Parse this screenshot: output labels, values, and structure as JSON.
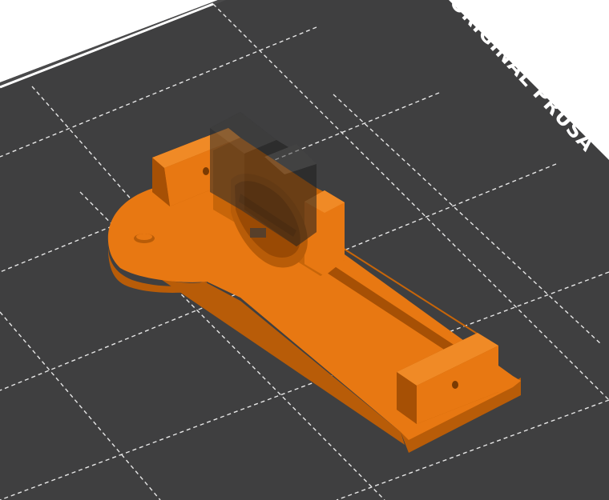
{
  "viewer": {
    "bed_label": "ORIGINAL PRUSA",
    "colors": {
      "background": "#ffffff",
      "bed": "#3f3f40",
      "bed_edge": "#353536",
      "grid": "#e6e6e6",
      "part": "#e87812",
      "part_shadow": "#b85c08",
      "part_dark": "#8a4302",
      "ghost": "#2b2b2b"
    },
    "scene": {
      "objects": [
        {
          "name": "orange-printed-part",
          "color": "#e87812"
        },
        {
          "name": "translucent-modifier-volume",
          "color": "#2b2b2b",
          "opacity": 0.55
        }
      ]
    }
  }
}
